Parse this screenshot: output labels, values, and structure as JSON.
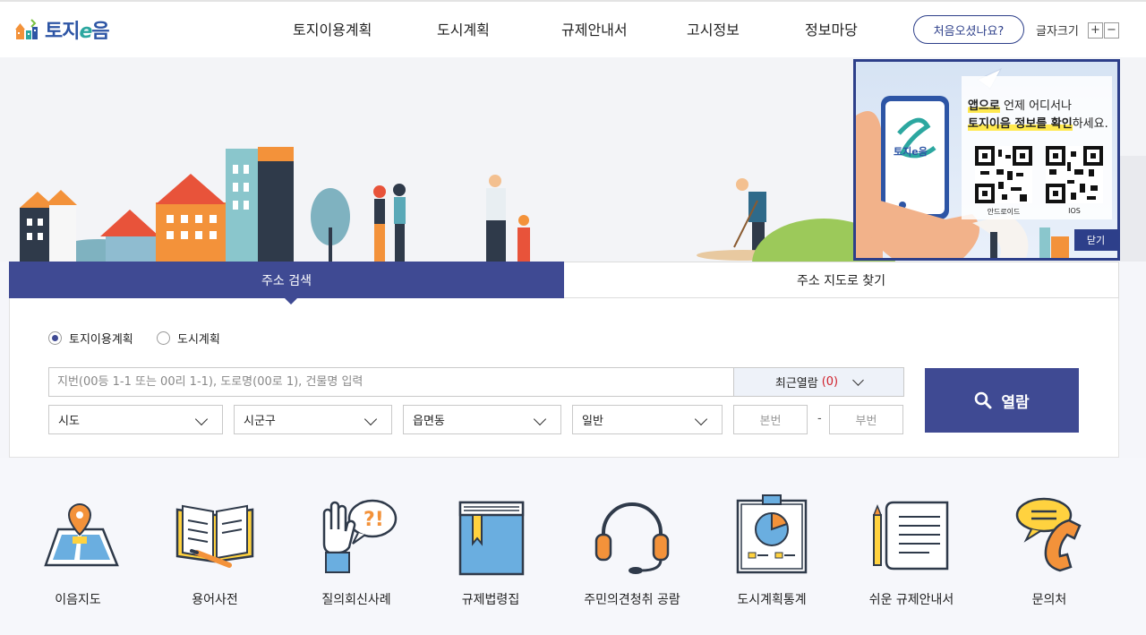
{
  "header": {
    "logo_text": "토지",
    "logo_e": "e",
    "logo_text2": "음",
    "nav": [
      {
        "label": "토지이용계획"
      },
      {
        "label": "도시계획"
      },
      {
        "label": "규제안내서"
      },
      {
        "label": "고시정보"
      },
      {
        "label": "정보마당"
      }
    ],
    "first_visit": "처음오셨나요?",
    "font_size_label": "글자크기",
    "font_plus": "+",
    "font_minus": "−"
  },
  "popup": {
    "line1_highlight": "앱으로",
    "line1_rest": " 언제 어디서나",
    "line2_highlight": "토지이음 정보를 확인",
    "line2_rest": "하세요.",
    "qr_android": "안드로이드",
    "qr_ios": "IOS",
    "close": "닫기",
    "phone_logo": "토지e음"
  },
  "search": {
    "tabs": [
      {
        "label": "주소 검색"
      },
      {
        "label": "주소 지도로 찾기"
      }
    ],
    "radios": [
      {
        "label": "토지이용계획",
        "checked": true
      },
      {
        "label": "도시계획",
        "checked": false
      }
    ],
    "input_placeholder": "지번(00등 1-1 또는 00리 1-1), 도로명(00로 1), 건물명 입력",
    "recent_label": "최근열람",
    "recent_count": "(0)",
    "selects": [
      {
        "value": "시도"
      },
      {
        "value": "시군구"
      },
      {
        "value": "읍면동"
      },
      {
        "value": "일반"
      }
    ],
    "bonbun": "본번",
    "bubun": "부번",
    "dash": "-",
    "open_label": "열람"
  },
  "shortcuts": [
    {
      "label": "이음지도",
      "icon": "map-pin-icon"
    },
    {
      "label": "용어사전",
      "icon": "open-book-icon"
    },
    {
      "label": "질의회신사례",
      "icon": "raised-hand-question-icon"
    },
    {
      "label": "규제법령집",
      "icon": "law-book-icon"
    },
    {
      "label": "주민의견청취 공람",
      "icon": "headset-icon"
    },
    {
      "label": "도시계획통계",
      "icon": "pie-chart-board-icon"
    },
    {
      "label": "쉬운 규제안내서",
      "icon": "scroll-pencil-icon"
    },
    {
      "label": "문의처",
      "icon": "phone-chat-icon"
    }
  ],
  "colors": {
    "primary": "#3f4a93",
    "logo_blue": "#2d55a5",
    "orange": "#f3923a",
    "highlight": "#ffe94f"
  }
}
